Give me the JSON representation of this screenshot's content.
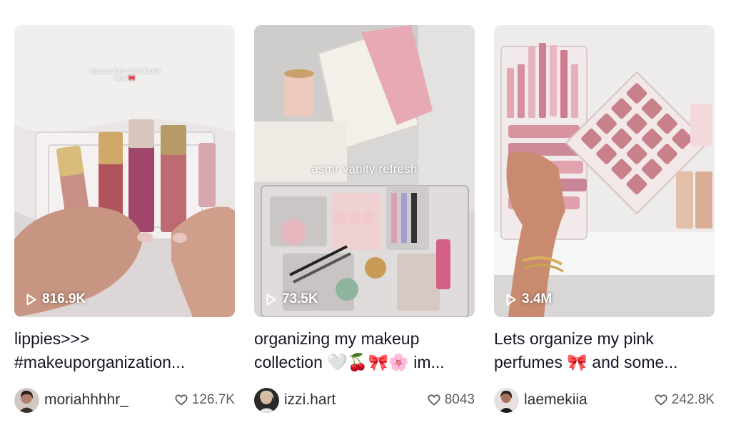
{
  "videos": [
    {
      "overlay_text": "organize some of my lippies w/me🎀",
      "views": "816.9K",
      "caption_line1": "lippies>>>",
      "caption_line2": "#makeuporganization...",
      "author": "moriahhhhr_",
      "likes": "126.7K"
    },
    {
      "overlay_text": "asmr vanity refresh",
      "views": "73.5K",
      "caption_line1": "organizing my makeup",
      "caption_line2": "collection 🤍🍒🎀🌸 im...",
      "author": "izzi.hart",
      "likes": "8043"
    },
    {
      "overlay_text": "",
      "views": "3.4M",
      "caption_line1": "Lets organize my pink",
      "caption_line2": "perfumes 🎀 and some...",
      "author": "laemekiia",
      "likes": "242.8K"
    }
  ],
  "icons": {
    "play": "play-icon",
    "like": "heart-icon"
  }
}
